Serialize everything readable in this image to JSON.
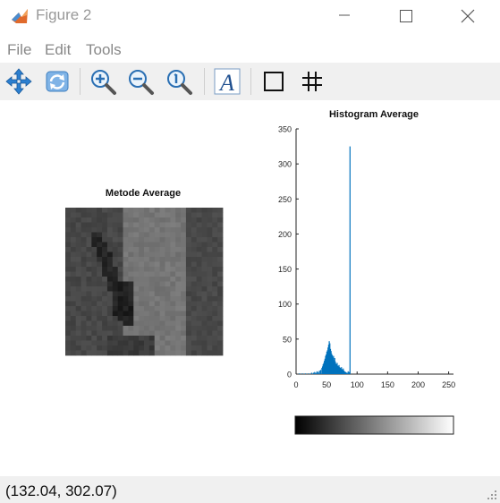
{
  "window": {
    "title": "Figure 2",
    "icon": "matlab-figure-icon",
    "controls": [
      "minimize-icon",
      "maximize-icon",
      "close-icon"
    ]
  },
  "menu": {
    "items": [
      "File",
      "Edit",
      "Tools"
    ]
  },
  "toolbar": {
    "tools": [
      "pan-icon",
      "rotate-icon",
      "zoom-in-icon",
      "zoom-out-icon",
      "zoom-reset-icon",
      "text-edit-icon",
      "box-icon",
      "grid-icon"
    ]
  },
  "figure": {
    "image_axes": {
      "title": "Metode Average"
    },
    "histogram": {
      "title": "Histogram Average"
    },
    "colorbar": {
      "colormap": "gray"
    }
  },
  "chart_data": {
    "type": "bar",
    "title": "Histogram Average",
    "xlabel": "",
    "ylabel": "",
    "xlim": [
      0,
      255
    ],
    "ylim": [
      0,
      350
    ],
    "x_ticks": [
      0,
      50,
      100,
      150,
      200,
      250
    ],
    "y_ticks": [
      0,
      50,
      100,
      150,
      200,
      250,
      300,
      350
    ],
    "bar_color": "#0072bd",
    "x": [
      5,
      10,
      15,
      20,
      25,
      28,
      30,
      32,
      34,
      36,
      38,
      40,
      42,
      43,
      44,
      45,
      46,
      47,
      48,
      49,
      50,
      51,
      52,
      53,
      54,
      55,
      56,
      57,
      58,
      59,
      60,
      61,
      62,
      63,
      64,
      65,
      66,
      67,
      68,
      69,
      70,
      71,
      72,
      73,
      74,
      75,
      76,
      77,
      78,
      79,
      80,
      81,
      82,
      83,
      84,
      85,
      86,
      87,
      88
    ],
    "values": [
      1,
      1,
      1,
      1,
      2,
      2,
      3,
      2,
      4,
      3,
      5,
      6,
      9,
      11,
      14,
      16,
      19,
      22,
      26,
      28,
      32,
      34,
      38,
      42,
      47,
      44,
      36,
      33,
      29,
      27,
      24,
      26,
      20,
      23,
      18,
      15,
      14,
      16,
      12,
      11,
      13,
      10,
      9,
      8,
      10,
      7,
      6,
      8,
      5,
      4,
      3,
      3,
      2,
      2,
      1,
      4,
      2,
      3,
      325
    ]
  },
  "status": {
    "coords": "(132.04, 302.07)"
  }
}
